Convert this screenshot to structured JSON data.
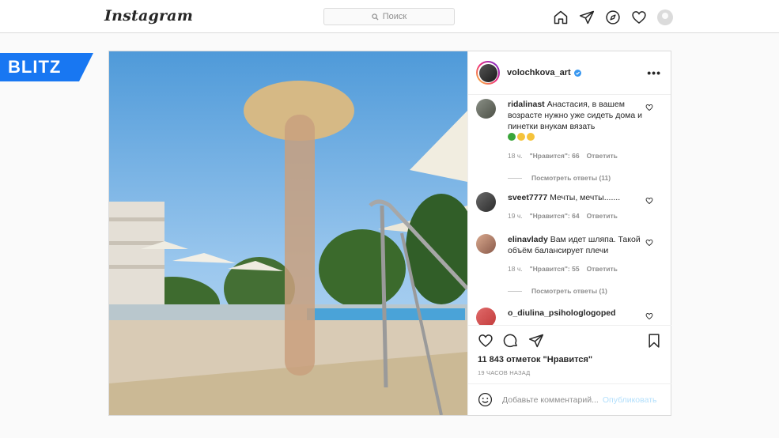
{
  "nav": {
    "logo": "Instagram",
    "search_placeholder": "Поиск",
    "icons": [
      "home-icon",
      "direct-icon",
      "explore-icon",
      "activity-heart-icon",
      "profile-avatar"
    ]
  },
  "badge": {
    "text": "BLITZ",
    "color": "#1877f2"
  },
  "post": {
    "username": "volochkova_art",
    "verified": true,
    "more_label": "•••",
    "comments": [
      {
        "user": "ridalinast",
        "text": "Анастасия, в вашем возрасте нужно уже сидеть дома и пинетки внукам вязать",
        "emojis": [
          "green-emoji",
          "upside-down-emoji",
          "grin-emoji"
        ],
        "time": "18 ч.",
        "likes": "\"Нравится\": 66",
        "reply": "Ответить",
        "view_replies": "Посмотреть ответы (11)"
      },
      {
        "user": "sveet7777",
        "text": "Мечты, мечты.......",
        "time": "19 ч.",
        "likes": "\"Нравится\": 64",
        "reply": "Ответить"
      },
      {
        "user": "elinavlady",
        "text": "Вам идет шляпа. Такой объём балансирует плечи",
        "time": "18 ч.",
        "likes": "\"Нравится\": 55",
        "reply": "Ответить",
        "view_replies": "Посмотреть ответы (1)"
      },
      {
        "user": "o_diulina_psihologlogoped",
        "text": ""
      }
    ],
    "likes_count": "11 843 отметок \"Нравится\"",
    "time_ago": "19 ЧАСОВ НАЗАД",
    "comment_placeholder": "Добавьте комментарий...",
    "publish_label": "Опубликовать"
  }
}
